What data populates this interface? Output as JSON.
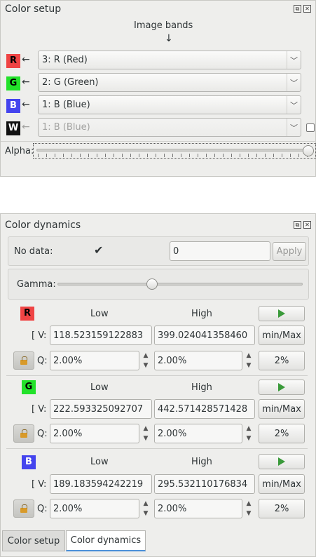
{
  "color_setup": {
    "title": "Color setup",
    "image_bands_label": "Image bands",
    "image_bands_arrow": "↓",
    "bands": [
      {
        "key": "R",
        "value": "3: R (Red)",
        "color": "#ef4444",
        "enabled": true
      },
      {
        "key": "G",
        "value": "2: G (Green)",
        "color": "#22e22a",
        "enabled": true
      },
      {
        "key": "B",
        "value": "1: B (Blue)",
        "color": "#4444ee",
        "enabled": true
      },
      {
        "key": "W",
        "value": "1: B (Blue)",
        "color": "#111111",
        "enabled": false
      }
    ],
    "arrow_glyph": "←",
    "alpha_label": "Alpha:",
    "alpha_value": 1.0
  },
  "color_dynamics": {
    "title": "Color dynamics",
    "no_data_label": "No data:",
    "no_data_checked": true,
    "no_data_value": "0",
    "apply_label": "Apply",
    "gamma_label": "Gamma:",
    "gamma_value": 0.5,
    "low_header": "Low",
    "high_header": "High",
    "v_label": "[ V:",
    "q_label": "Q:",
    "minmax_label": "min/Max",
    "percent_label": "2%",
    "channels": [
      {
        "key": "R",
        "color": "#ef4444",
        "low_v": "118.523159122883",
        "high_v": "399.024041358460",
        "low_q": "2.00%",
        "high_q": "2.00%"
      },
      {
        "key": "G",
        "color": "#22e22a",
        "low_v": "222.593325092707",
        "high_v": "442.571428571428",
        "low_q": "2.00%",
        "high_q": "2.00%"
      },
      {
        "key": "B",
        "color": "#4444ee",
        "low_v": "189.183594242219",
        "high_v": "295.532110176834",
        "low_q": "2.00%",
        "high_q": "2.00%"
      }
    ]
  },
  "tabs": [
    {
      "label": "Color setup",
      "active": false
    },
    {
      "label": "Color dynamics",
      "active": true
    }
  ]
}
